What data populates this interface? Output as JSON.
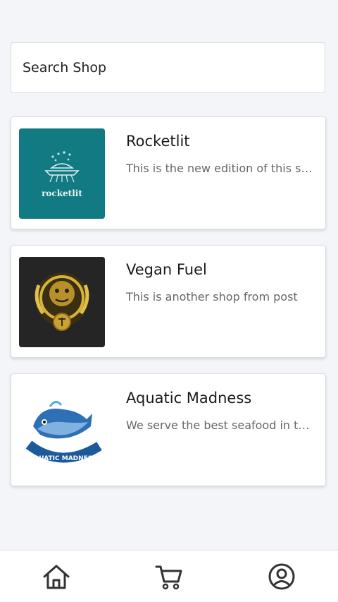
{
  "search": {
    "placeholder": "Search Shop"
  },
  "shops": [
    {
      "name": "Rocketlit",
      "description": "This is the new edition of this shop",
      "logo_text": "rocketlit",
      "logo_bg": "#117a82"
    },
    {
      "name": "Vegan Fuel",
      "description": "This is another shop from post",
      "logo_bg": "#222222"
    },
    {
      "name": "Aquatic Madness",
      "description": "We serve the best seafood in town",
      "logo_text": "AQUATIC MADNESS",
      "logo_bg": "#ffffff"
    }
  ],
  "nav": {
    "items": [
      {
        "icon": "home-icon"
      },
      {
        "icon": "cart-icon"
      },
      {
        "icon": "account-icon"
      }
    ]
  },
  "colors": {
    "background": "#f4f5f8",
    "card": "#ffffff",
    "icon": "#333333"
  }
}
